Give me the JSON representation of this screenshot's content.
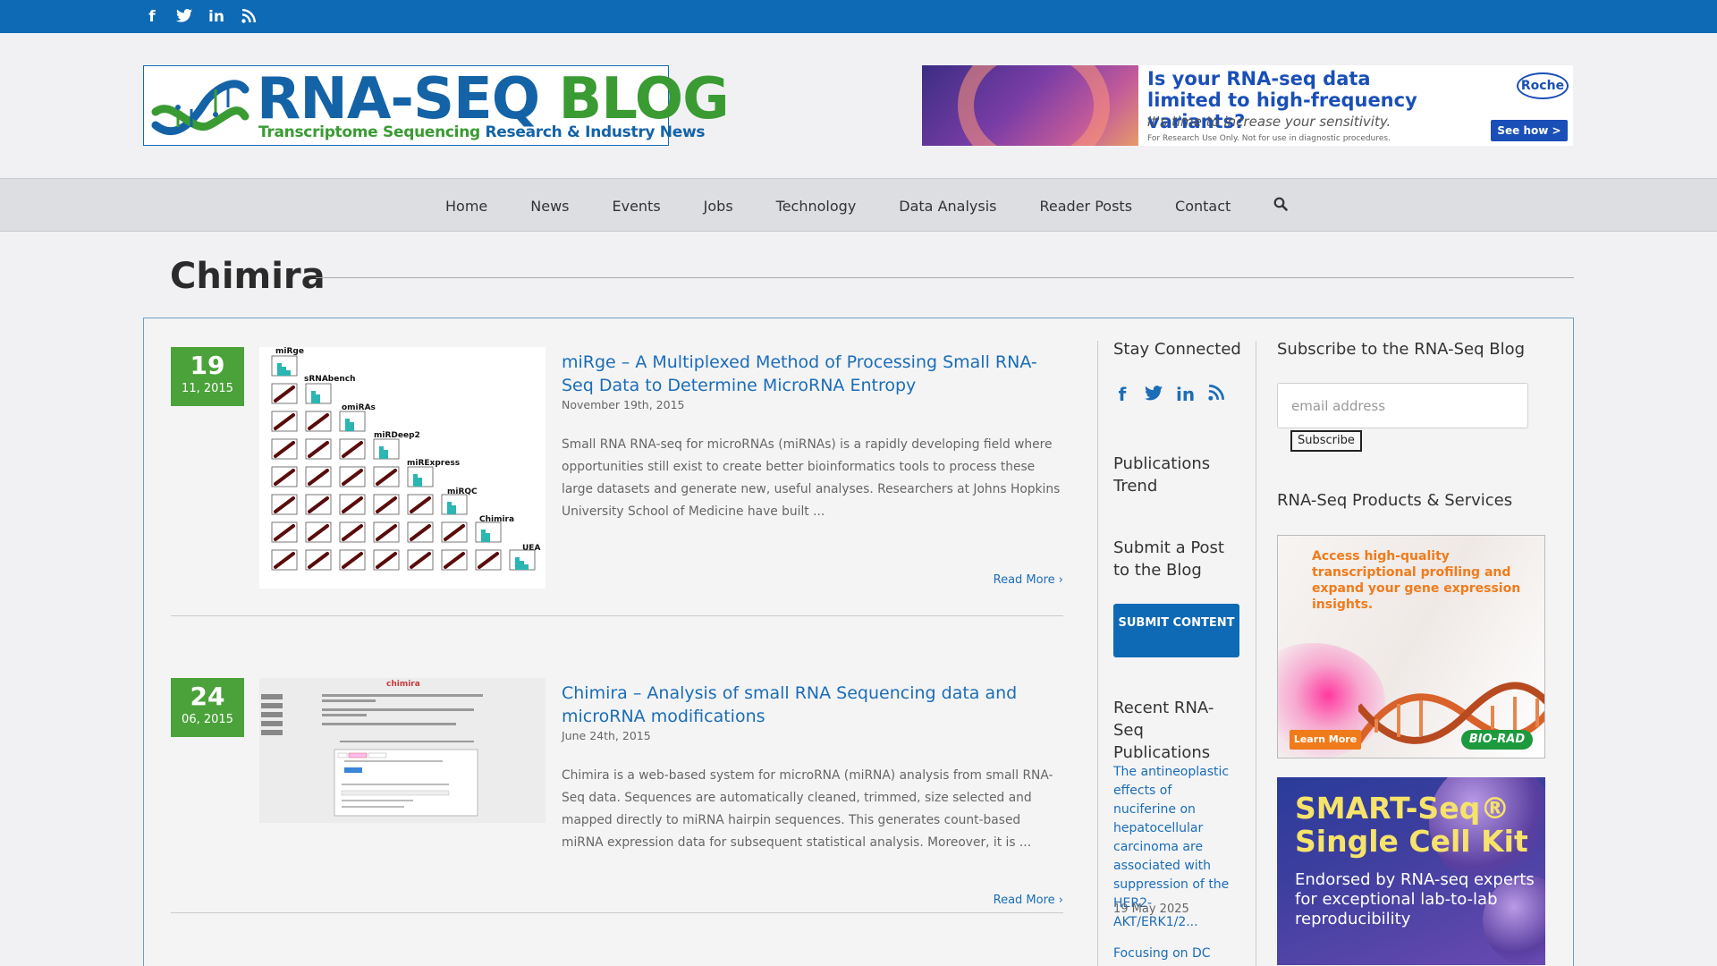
{
  "top_bar": {
    "social_icons": [
      {
        "name": "facebook-icon",
        "glyph": "f"
      },
      {
        "name": "twitter-icon",
        "glyph": "🐦"
      },
      {
        "name": "linkedin-icon",
        "glyph": "in"
      },
      {
        "name": "rss-icon",
        "glyph": "⌒"
      }
    ]
  },
  "header": {
    "logo_title_1": "RNA-SEQ",
    "logo_title_2": "BLOG",
    "logo_subtitle_1": "Transcriptome Sequencing",
    "logo_subtitle_2": "Research & Industry News",
    "ad": {
      "headline": "Is your RNA-seq data limited to high-frequency variants?",
      "subline": "It's time to increase your sensitivity.",
      "fine_print": "For Research Use Only. Not for use in diagnostic procedures.",
      "brand": "Roche",
      "button": "See how >"
    }
  },
  "nav": {
    "items": [
      "Home",
      "News",
      "Events",
      "Jobs",
      "Technology",
      "Data Analysis",
      "Reader Posts",
      "Contact"
    ],
    "search_icon": "search-icon"
  },
  "page": {
    "title": "Chimira"
  },
  "posts": [
    {
      "day": "19",
      "month_year": "11, 2015",
      "title": "miRge – A Multiplexed Method of Processing Small RNA-Seq Data to Determine MicroRNA Entropy",
      "date": "November 19th, 2015",
      "excerpt": "Small RNA RNA-seq for microRNAs (miRNAs) is a rapidly developing field where opportunities still exist to create better bioinformatics tools to process these large datasets and generate new, useful analyses. Researchers at Johns Hopkins University School of Medicine have built ...",
      "read_more": "Read More",
      "thumb_labels": [
        "miRge",
        "sRNAbench",
        "omiRAs",
        "miRDeep2",
        "miRExpress",
        "miRQC",
        "Chimira",
        "UEA"
      ]
    },
    {
      "day": "24",
      "month_year": "06, 2015",
      "title": "Chimira – Analysis of small RNA Sequencing data and microRNA modifications",
      "date": "June 24th, 2015",
      "excerpt": "Chimira is a web-based system for microRNA (miRNA) analysis from small RNA-Seq data. Sequences are automatically cleaned, trimmed, size selected and mapped directly to miRNA hairpin sequences. This generates count-based miRNA expression data for subsequent statistical analysis. Moreover, it is ...",
      "read_more": "Read More",
      "thumb_title": "chimira"
    }
  ],
  "sidebar1": {
    "stay_connected": "Stay Connected",
    "publications_trend": "Publications Trend",
    "submit_post": "Submit a Post to the Blog",
    "submit_button": "SUBMIT CONTENT",
    "recent_pubs": "Recent RNA-Seq Publications",
    "recent_items": [
      {
        "title": "The antineoplastic effects of nuciferine on hepatocellular carcinoma are associated with suppression of the HER2-AKT/ERK1/2...",
        "date": "19 May 2025"
      },
      {
        "title": "Focusing on DC cells"
      }
    ]
  },
  "sidebar2": {
    "subscribe_heading": "Subscribe to the RNA-Seq Blog",
    "email_placeholder": "email address",
    "subscribe_button": "Subscribe",
    "products_heading": "RNA-Seq Products & Services",
    "ad_bio": {
      "text": "Access high-quality transcriptional profiling and expand your gene expression insights.",
      "button": "Learn More",
      "brand": "BIO-RAD"
    },
    "ad_smart": {
      "title_1": "SMART-Seq®",
      "title_2": "Single Cell Kit",
      "subtitle": "Endorsed by RNA-seq experts for exceptional lab-to-lab reproducibility"
    }
  },
  "colors": {
    "top_bar": "#0e6ab5",
    "accent_blue": "#1b6db7",
    "date_green": "#4ba23a"
  }
}
